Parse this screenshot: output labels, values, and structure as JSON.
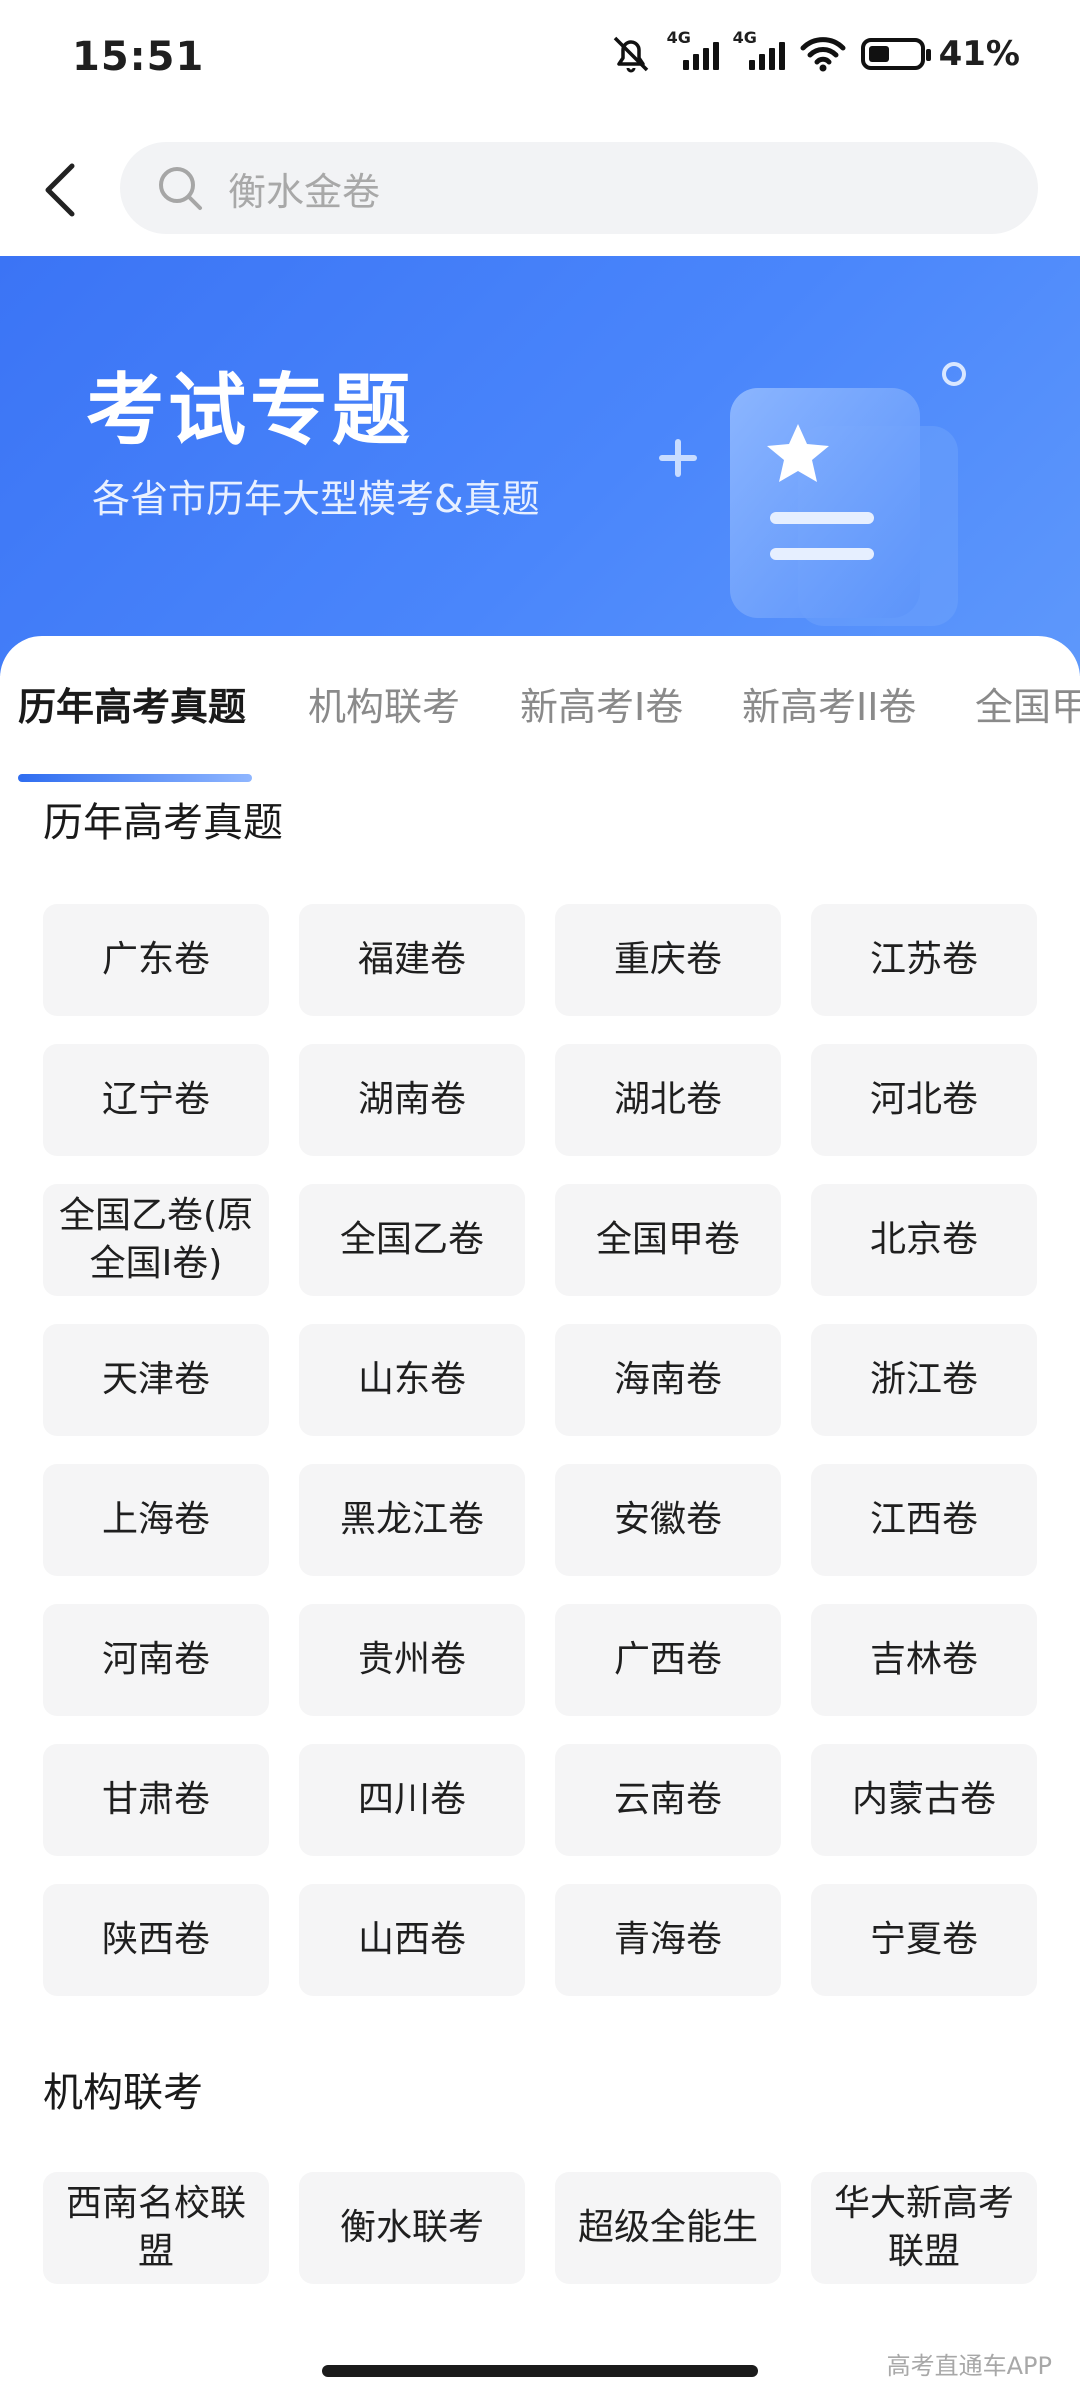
{
  "status_bar": {
    "time": "15:51",
    "network_tag_1": "4G",
    "network_tag_2": "4G",
    "battery_percent": 41,
    "battery_text": "41%"
  },
  "header": {
    "search_placeholder": "衡水金卷"
  },
  "banner": {
    "title": "考试专题",
    "subtitle": "各省市历年大型模考&真题"
  },
  "tabs": [
    {
      "label": "历年高考真题",
      "active": true
    },
    {
      "label": "机构联考"
    },
    {
      "label": "新高考I卷"
    },
    {
      "label": "新高考II卷"
    },
    {
      "label": "全国甲"
    }
  ],
  "sections": [
    {
      "title": "历年高考真题",
      "items": [
        "广东卷",
        "福建卷",
        "重庆卷",
        "江苏卷",
        "辽宁卷",
        "湖南卷",
        "湖北卷",
        "河北卷",
        "全国乙卷(原全国I卷)",
        "全国乙卷",
        "全国甲卷",
        "北京卷",
        "天津卷",
        "山东卷",
        "海南卷",
        "浙江卷",
        "上海卷",
        "黑龙江卷",
        "安徽卷",
        "江西卷",
        "河南卷",
        "贵州卷",
        "广西卷",
        "吉林卷",
        "甘肃卷",
        "四川卷",
        "云南卷",
        "内蒙古卷",
        "陕西卷",
        "山西卷",
        "青海卷",
        "宁夏卷"
      ]
    },
    {
      "title": "机构联考",
      "items": [
        "西南名校联盟",
        "衡水联考",
        "超级全能生",
        "华大新高考联盟"
      ]
    }
  ],
  "watermark": "高考直通车APP",
  "colors": {
    "accent": "#3b74f5",
    "chip_bg": "#f5f5f6",
    "search_bg": "#f2f3f5"
  }
}
